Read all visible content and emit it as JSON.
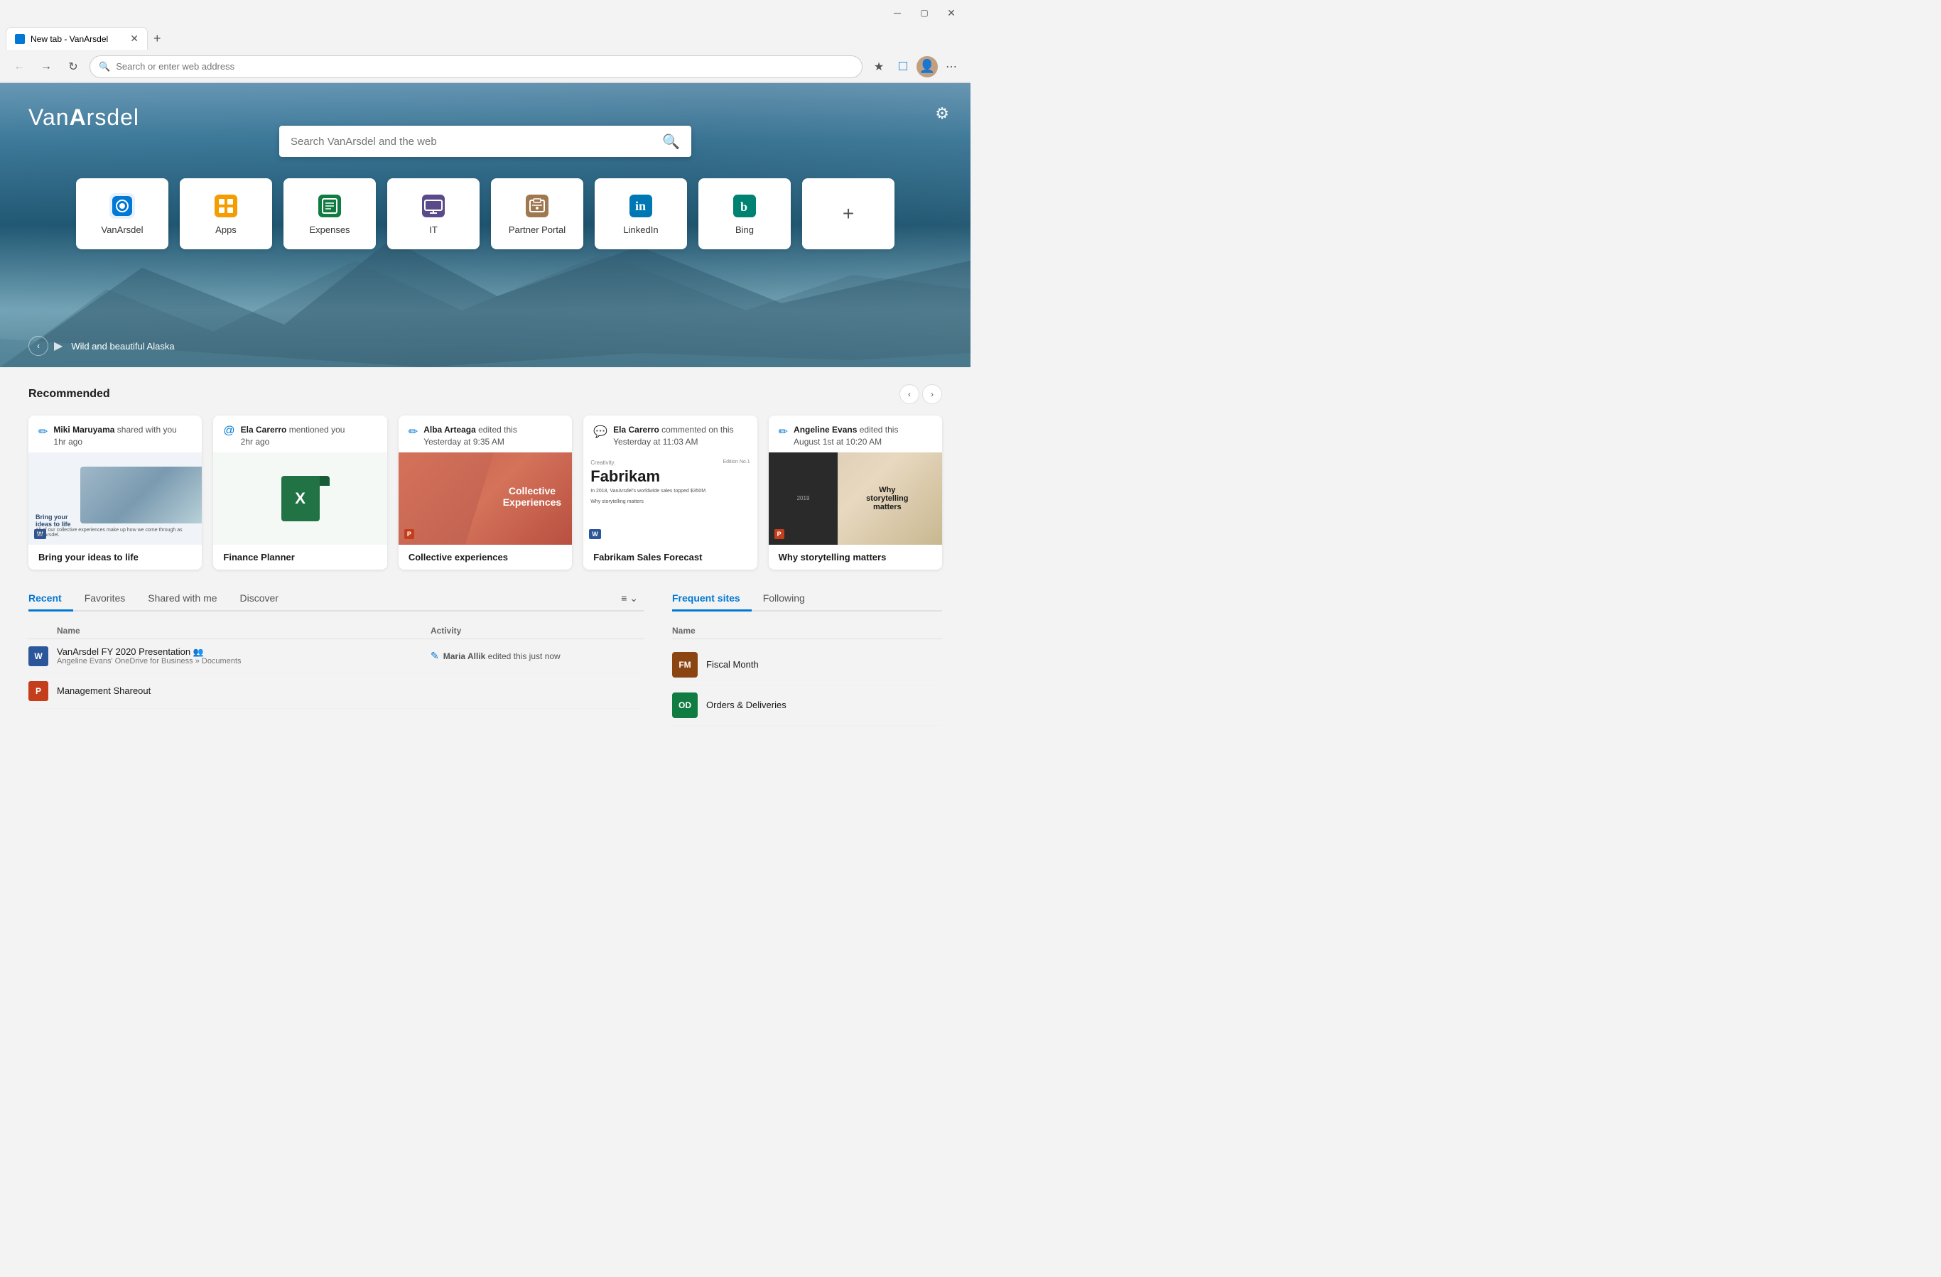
{
  "browser": {
    "title": "New tab - VanArsdel",
    "tab_label": "New tab - VanArsdel",
    "address": "",
    "address_placeholder": "Search or enter web address"
  },
  "hero": {
    "logo": "VanArsdel",
    "search_placeholder": "Search VanArsdel and the web",
    "caption": "Wild and beautiful Alaska",
    "gear_label": "⚙"
  },
  "quick_links": [
    {
      "id": "vanarsdel",
      "label": "VanArsdel",
      "icon": "🔷",
      "color": "#0078d4"
    },
    {
      "id": "apps",
      "label": "Apps",
      "icon": "🟧",
      "color": "#f59c00"
    },
    {
      "id": "expenses",
      "label": "Expenses",
      "icon": "🟩",
      "color": "#107c41"
    },
    {
      "id": "it",
      "label": "IT",
      "icon": "🟪",
      "color": "#5a4a8a"
    },
    {
      "id": "partner",
      "label": "Partner Portal",
      "icon": "🟫",
      "color": "#a07850"
    },
    {
      "id": "linkedin",
      "label": "LinkedIn",
      "icon": "in",
      "color": "#0077b5"
    },
    {
      "id": "bing",
      "label": "Bing",
      "icon": "b",
      "color": "#008272"
    }
  ],
  "recommended": {
    "title": "Recommended",
    "prev_label": "❮",
    "next_label": "❯",
    "cards": [
      {
        "id": "bring-your-ideas",
        "actor": "Miki Maruyama",
        "action": "shared with you",
        "time": "1hr ago",
        "icon_type": "pencil",
        "title": "Bring your ideas to life",
        "type": "word"
      },
      {
        "id": "finance-planner",
        "actor": "Ela Carerro",
        "action": "mentioned you",
        "time": "2hr ago",
        "icon_type": "mention",
        "title": "Finance Planner",
        "type": "excel"
      },
      {
        "id": "collective-experiences",
        "actor": "Alba Arteaga",
        "action": "edited this",
        "time": "Yesterday at 9:35 AM",
        "icon_type": "pencil",
        "title": "Collective experiences",
        "type": "ppt1"
      },
      {
        "id": "fabrikam-sales",
        "actor": "Ela Carerro",
        "action": "commented on this",
        "time": "Yesterday at 11:03 AM",
        "icon_type": "comment",
        "title": "Fabrikam Sales Forecast",
        "type": "word2"
      },
      {
        "id": "why-storytelling",
        "actor": "Angeline Evans",
        "action": "edited this",
        "time": "August 1st at 10:20 AM",
        "icon_type": "pencil",
        "title": "Why storytelling matters",
        "type": "ppt2"
      }
    ]
  },
  "files": {
    "tabs": [
      "Recent",
      "Favorites",
      "Shared with me",
      "Discover"
    ],
    "active_tab": "Recent",
    "col_name": "Name",
    "col_activity": "Activity",
    "rows": [
      {
        "name": "VanArsdel FY 2020 Presentation",
        "sub": "Angeline Evans' OneDrive for Business » Documents",
        "activity_actor": "Maria Allik",
        "activity_action": "edited this just now",
        "icon_type": "word",
        "shared": true
      },
      {
        "name": "Management Shareout",
        "sub": "",
        "activity_actor": "",
        "activity_action": "",
        "icon_type": "ppt",
        "shared": false
      }
    ]
  },
  "sites": {
    "tabs": [
      "Frequent sites",
      "Following"
    ],
    "active_tab": "Frequent sites",
    "col_name": "Name",
    "rows": [
      {
        "abbr": "FM",
        "name": "Fiscal Month",
        "color": "#8b4513"
      },
      {
        "abbr": "OD",
        "name": "Orders & Deliveries",
        "color": "#107c41"
      }
    ]
  }
}
